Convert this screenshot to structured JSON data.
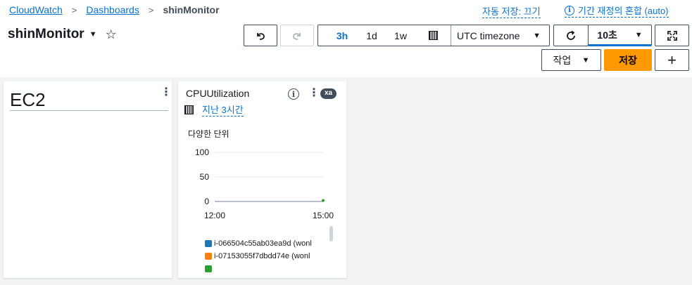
{
  "breadcrumb": {
    "item1": "CloudWatch",
    "item2": "Dashboards",
    "current": "shinMonitor"
  },
  "autosave_label": "자동 저장: 끄기",
  "period_mix_label": "기간 재정의 혼합 (auto)",
  "dashboard": {
    "title": "shinMonitor"
  },
  "toolbar": {
    "undo_icon": "undo-icon",
    "redo_icon": "redo-icon",
    "time_ranges": [
      "3h",
      "1d",
      "1w"
    ],
    "active_range": "3h",
    "timezone": "UTC timezone",
    "refresh_interval": "10초",
    "actions_label": "작업",
    "save_label": "저장",
    "add_label": "+"
  },
  "widgets": {
    "ec2": {
      "title": "EC2"
    },
    "cpu": {
      "title": "CPUUtilization",
      "badge": "xa",
      "period": "지난 3시간",
      "unit_label": "다양한 단위",
      "legend": [
        {
          "label": "i-066504c55ab03ea9d (wonl",
          "color": "#1f77b4"
        },
        {
          "label": "i-07153055f7dbdd74e (wonl",
          "color": "#ff7f0e"
        },
        {
          "label": "",
          "color": "#2ca02c"
        }
      ]
    }
  },
  "chart_data": {
    "type": "line",
    "y_ticks": [
      "100",
      "50",
      "0"
    ],
    "x_ticks": [
      "12:00",
      "15:00"
    ],
    "ylim": [
      0,
      100
    ],
    "series": [
      {
        "name": "i-066504c55ab03ea9d (wonl",
        "color": "#1f77b4",
        "points": []
      },
      {
        "name": "i-07153055f7dbdd74e (wonl",
        "color": "#ff7f0e",
        "points": []
      },
      {
        "color": "#2ca02c",
        "points": [
          {
            "x": "15:00",
            "y": 0.5
          }
        ]
      }
    ]
  }
}
